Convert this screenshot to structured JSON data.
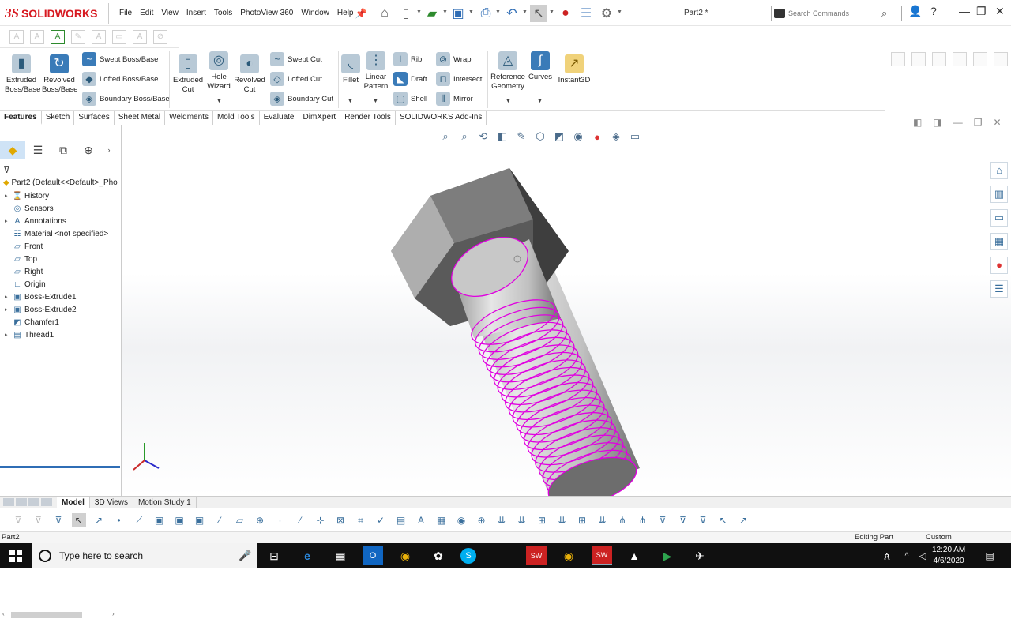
{
  "app": {
    "logo_prefix": "3S",
    "logo_name": "SOLIDWORKS",
    "menu": [
      "File",
      "Edit",
      "View",
      "Insert",
      "Tools",
      "PhotoView 360",
      "Window",
      "Help"
    ],
    "doc_title": "Part2 *",
    "search_placeholder": "Search Commands"
  },
  "commands": {
    "extruded_boss": "Extruded Boss/Base",
    "revolved_boss": "Revolved Boss/Base",
    "swept_boss": "Swept Boss/Base",
    "lofted_boss": "Lofted Boss/Base",
    "boundary_boss": "Boundary Boss/Base",
    "extruded_cut": "Extruded Cut",
    "hole_wizard": "Hole Wizard",
    "revolved_cut": "Revolved Cut",
    "swept_cut": "Swept Cut",
    "lofted_cut": "Lofted Cut",
    "boundary_cut": "Boundary Cut",
    "fillet": "Fillet",
    "linear_pattern": "Linear Pattern",
    "rib": "Rib",
    "draft": "Draft",
    "shell": "Shell",
    "wrap": "Wrap",
    "intersect": "Intersect",
    "mirror": "Mirror",
    "reference_geometry": "Reference Geometry",
    "curves": "Curves",
    "instant3d": "Instant3D"
  },
  "tabs": [
    "Features",
    "Sketch",
    "Surfaces",
    "Sheet Metal",
    "Weldments",
    "Mold Tools",
    "Evaluate",
    "DimXpert",
    "Render Tools",
    "SOLIDWORKS Add-Ins"
  ],
  "tree": {
    "root": "Part2  (Default<<Default>_Pho",
    "items": [
      {
        "label": "History",
        "expand": "▸",
        "icon": "history-icon"
      },
      {
        "label": "Sensors",
        "expand": "",
        "icon": "sensors-icon"
      },
      {
        "label": "Annotations",
        "expand": "▸",
        "icon": "annotations-icon"
      },
      {
        "label": "Material <not specified>",
        "expand": "",
        "icon": "material-icon"
      },
      {
        "label": "Front",
        "expand": "",
        "icon": "plane-icon"
      },
      {
        "label": "Top",
        "expand": "",
        "icon": "plane-icon"
      },
      {
        "label": "Right",
        "expand": "",
        "icon": "plane-icon"
      },
      {
        "label": "Origin",
        "expand": "",
        "icon": "origin-icon"
      },
      {
        "label": "Boss-Extrude1",
        "expand": "▸",
        "icon": "extrude-icon"
      },
      {
        "label": "Boss-Extrude2",
        "expand": "▸",
        "icon": "extrude-icon"
      },
      {
        "label": "Chamfer1",
        "expand": "",
        "icon": "chamfer-icon"
      },
      {
        "label": "Thread1",
        "expand": "▸",
        "icon": "thread-icon"
      }
    ]
  },
  "bottom_tabs": [
    "Model",
    "3D Views",
    "Motion Study 1"
  ],
  "status": {
    "left": "Part2",
    "mode": "Editing Part",
    "units": "Custom"
  },
  "taskbar": {
    "search_placeholder": "Type here to search",
    "time": "12:20 AM",
    "date": "4/6/2020"
  },
  "colors": {
    "brand_red": "#d71920",
    "thread_magenta": "#e000e0",
    "selection_blue": "#2f6db5"
  }
}
